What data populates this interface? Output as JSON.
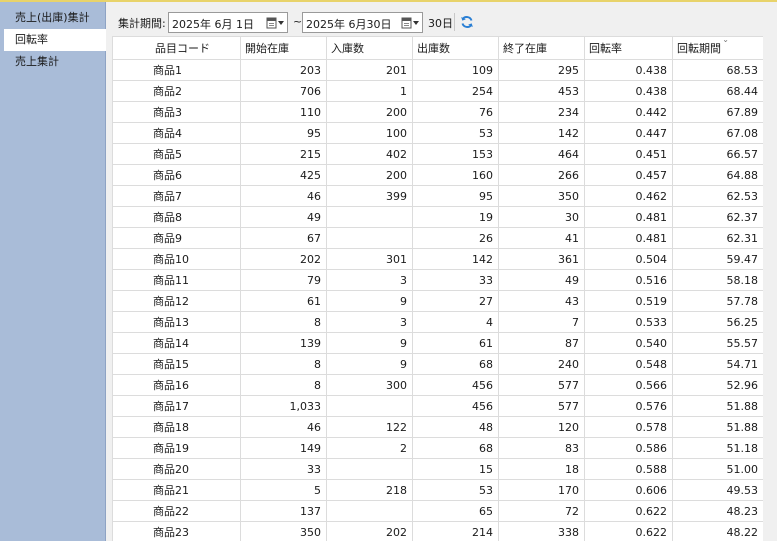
{
  "sidebar": {
    "items": [
      {
        "label": "売上(出庫)集計",
        "active": false
      },
      {
        "label": "回転率",
        "active": true
      },
      {
        "label": "売上集計",
        "active": false
      }
    ]
  },
  "toolbar": {
    "period_label": "集計期間:",
    "start_date": "2025年  6月  1日",
    "end_date": "2025年  6月30日",
    "tilde": "~",
    "days": "30日",
    "calendar_icon": "calendar-dropdown-icon",
    "refresh_icon": "refresh-icon",
    "refresh_color": "#2a7fd4"
  },
  "table": {
    "sorted_column": "回転期間",
    "columns": [
      "品目コード",
      "開始在庫",
      "入庫数",
      "出庫数",
      "終了在庫",
      "回転率",
      "回転期間"
    ],
    "rows": [
      [
        "商品1",
        "203",
        "201",
        "109",
        "295",
        "0.438",
        "68.53"
      ],
      [
        "商品2",
        "706",
        "1",
        "254",
        "453",
        "0.438",
        "68.44"
      ],
      [
        "商品3",
        "110",
        "200",
        "76",
        "234",
        "0.442",
        "67.89"
      ],
      [
        "商品4",
        "95",
        "100",
        "53",
        "142",
        "0.447",
        "67.08"
      ],
      [
        "商品5",
        "215",
        "402",
        "153",
        "464",
        "0.451",
        "66.57"
      ],
      [
        "商品6",
        "425",
        "200",
        "160",
        "266",
        "0.457",
        "64.88"
      ],
      [
        "商品7",
        "46",
        "399",
        "95",
        "350",
        "0.462",
        "62.53"
      ],
      [
        "商品8",
        "49",
        "",
        "19",
        "30",
        "0.481",
        "62.37"
      ],
      [
        "商品9",
        "67",
        "",
        "26",
        "41",
        "0.481",
        "62.31"
      ],
      [
        "商品10",
        "202",
        "301",
        "142",
        "361",
        "0.504",
        "59.47"
      ],
      [
        "商品11",
        "79",
        "3",
        "33",
        "49",
        "0.516",
        "58.18"
      ],
      [
        "商品12",
        "61",
        "9",
        "27",
        "43",
        "0.519",
        "57.78"
      ],
      [
        "商品13",
        "8",
        "3",
        "4",
        "7",
        "0.533",
        "56.25"
      ],
      [
        "商品14",
        "139",
        "9",
        "61",
        "87",
        "0.540",
        "55.57"
      ],
      [
        "商品15",
        "8",
        "9",
        "68",
        "240",
        "0.548",
        "54.71"
      ],
      [
        "商品16",
        "8",
        "300",
        "456",
        "577",
        "0.566",
        "52.96"
      ],
      [
        "商品17",
        "1,033",
        "",
        "456",
        "577",
        "0.576",
        "51.88"
      ],
      [
        "商品18",
        "46",
        "122",
        "48",
        "120",
        "0.578",
        "51.88"
      ],
      [
        "商品19",
        "149",
        "2",
        "68",
        "83",
        "0.586",
        "51.18"
      ],
      [
        "商品20",
        "33",
        "",
        "15",
        "18",
        "0.588",
        "51.00"
      ],
      [
        "商品21",
        "5",
        "218",
        "53",
        "170",
        "0.606",
        "49.53"
      ],
      [
        "商品22",
        "137",
        "",
        "65",
        "72",
        "0.622",
        "48.23"
      ],
      [
        "商品23",
        "350",
        "202",
        "214",
        "338",
        "0.622",
        "48.22"
      ]
    ]
  }
}
